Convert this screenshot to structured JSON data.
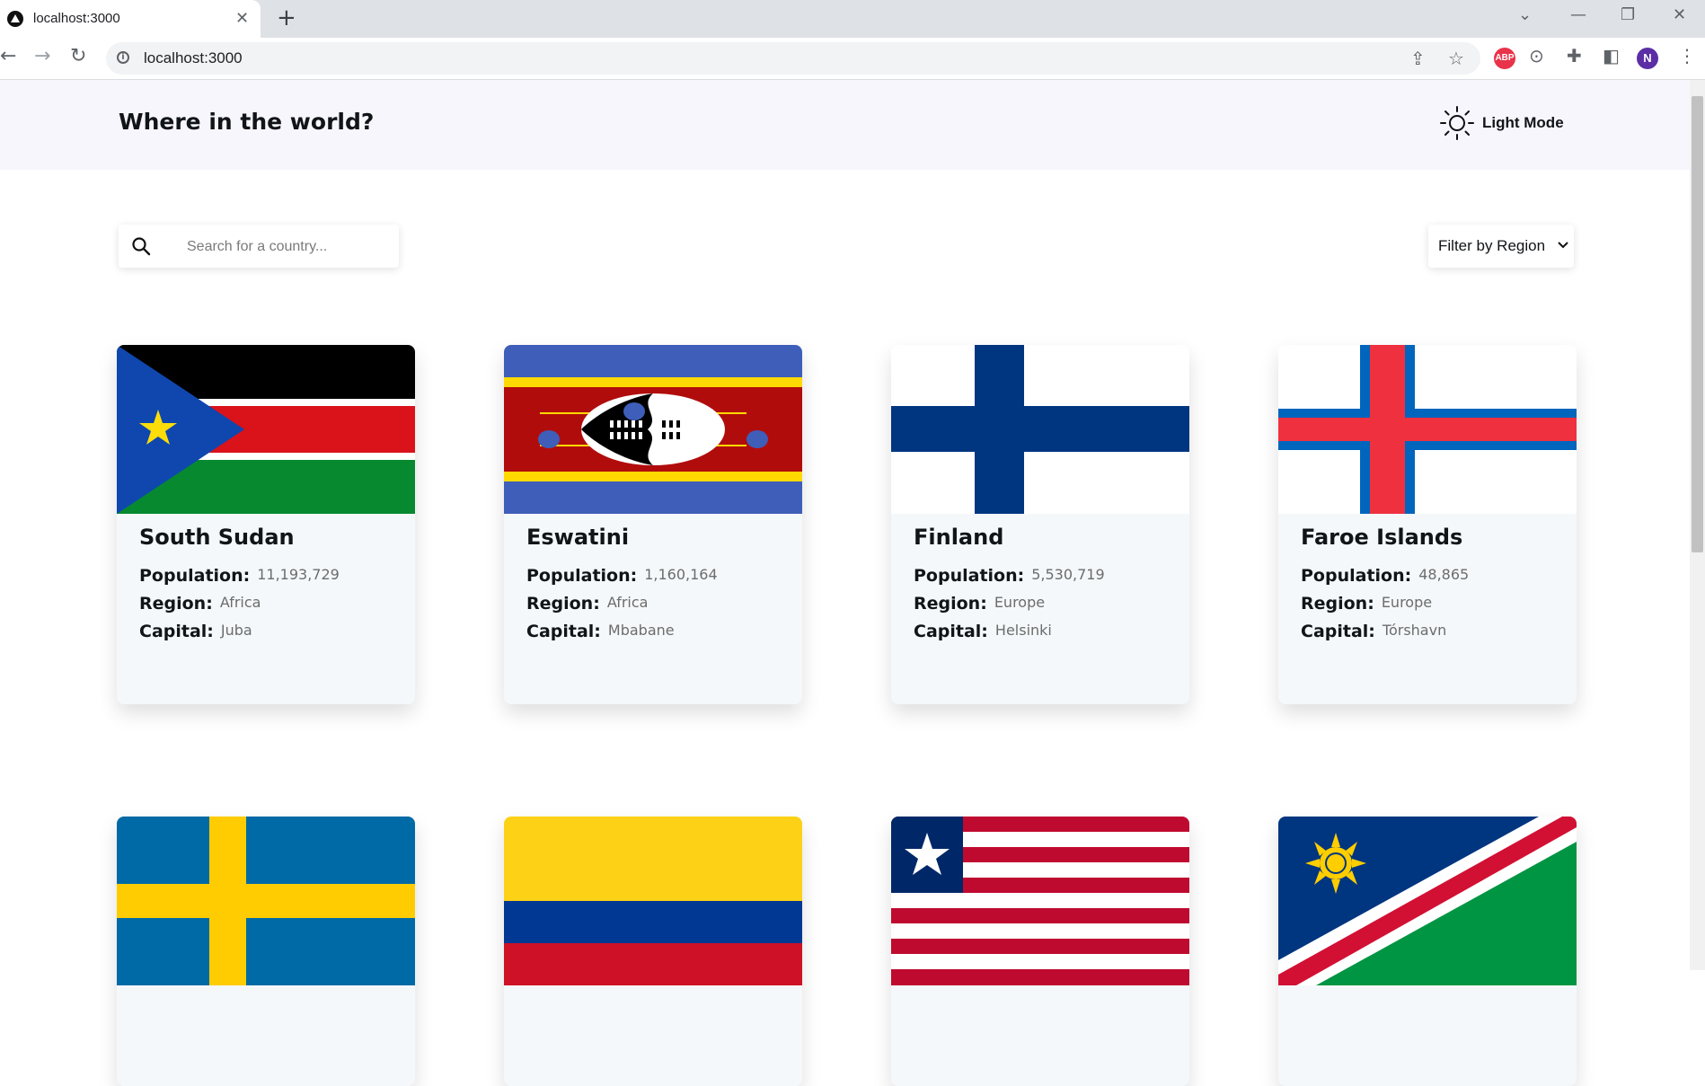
{
  "browser": {
    "tab_title": "localhost:3000",
    "url": "localhost:3000",
    "profile_initial": "N",
    "abp_label": "ABP"
  },
  "header": {
    "title": "Where in the world?",
    "mode_label": "Light Mode"
  },
  "search": {
    "placeholder": "Search for a country..."
  },
  "filter": {
    "label": "Filter by Region"
  },
  "labels": {
    "population": "Population:",
    "region": "Region:",
    "capital": "Capital:"
  },
  "countries": [
    {
      "name": "South Sudan",
      "population": "11,193,729",
      "region": "Africa",
      "capital": "Juba"
    },
    {
      "name": "Eswatini",
      "population": "1,160,164",
      "region": "Africa",
      "capital": "Mbabane"
    },
    {
      "name": "Finland",
      "population": "5,530,719",
      "region": "Europe",
      "capital": "Helsinki"
    },
    {
      "name": "Faroe Islands",
      "population": "48,865",
      "region": "Europe",
      "capital": "Tórshavn"
    }
  ],
  "second_row_flags": [
    "sweden-flag",
    "colombia-flag",
    "liberia-flag",
    "namibia-flag"
  ],
  "icons": {
    "theme": "sun-icon",
    "search": "search-icon",
    "dropdown": "chevron-down-icon"
  },
  "colors": {
    "header_bg": "#f8f6fd",
    "card_bg": "#f5f8fb",
    "text_dark": "#111517",
    "text_muted": "#6c6c6c"
  }
}
